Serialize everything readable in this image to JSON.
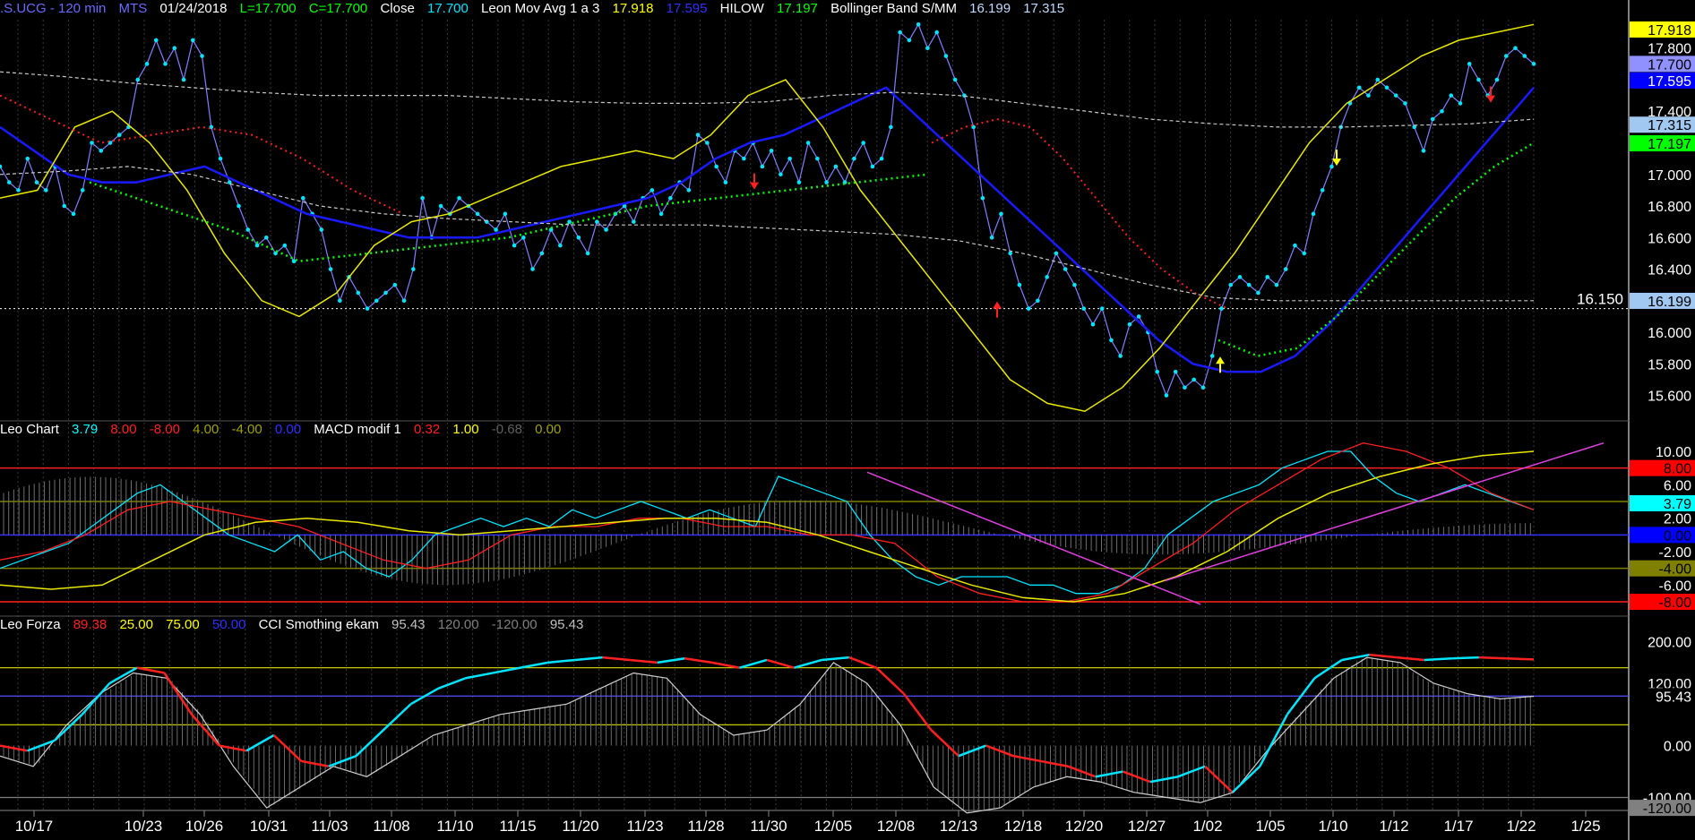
{
  "header": {
    "symbol": ".S.UCG - 120 min",
    "source": "MTS",
    "date": "01/24/2018",
    "low": "L=17.700",
    "close": "C=17.700",
    "close_label": "Close",
    "close_val": "17.700",
    "ma_label": "Leon Mov Avg 1 a 3",
    "ma_val1": "17.918",
    "ma_val2": "17.595",
    "hilow_label": "HILOW",
    "hilow_val": "17.197",
    "boll_label": "Bollinger Band S/MM",
    "boll_val1": "16.199",
    "boll_val2": "17.315"
  },
  "macd_header": {
    "label": "Leo Chart",
    "v1": "3.79",
    "v2": "8.00",
    "v3": "-8.00",
    "v4": "4.00",
    "v5": "-4.00",
    "v6": "0.00",
    "macd_label": "MACD modif 1",
    "m1": "0.32",
    "m2": "1.00",
    "m3": "-0.68",
    "m4": "0.00"
  },
  "forza_header": {
    "label": "Leo Forza",
    "v1": "89.38",
    "v2": "25.00",
    "v3": "75.00",
    "v4": "50.00",
    "cci_label": "CCI Smothing ekam",
    "c1": "95.43",
    "c2": "120.00",
    "c3": "-120.00",
    "c4": "95.43"
  },
  "colors": {
    "price": "#00e5ff",
    "blue": "#1a1aff",
    "yellow": "#e8e800",
    "red": "#ff2020",
    "green": "#00ff00",
    "white": "#c8c8c8",
    "magenta": "#e040e0"
  },
  "chart_data": [
    {
      "type": "line",
      "panel": "price",
      "ylim": [
        15.45,
        17.98
      ],
      "y_ticks": [
        "17.800",
        "17.400",
        "17.000",
        "16.800",
        "16.600",
        "16.400",
        "16.000",
        "15.800",
        "15.600"
      ],
      "y_tick_values": [
        17.8,
        17.4,
        17.0,
        16.8,
        16.6,
        16.4,
        16.0,
        15.8,
        15.6
      ],
      "hline_label": "16.150",
      "hline_value": 16.15,
      "tags": [
        {
          "text": "17.918",
          "value": 17.918,
          "bg": "#ffff00",
          "fg": "#000"
        },
        {
          "text": "17.700",
          "value": 17.7,
          "bg": "#9090ff",
          "fg": "#000"
        },
        {
          "text": "17.595",
          "value": 17.595,
          "bg": "#0000ff",
          "fg": "#fff"
        },
        {
          "text": "17.315",
          "value": 17.315,
          "bg": "#a0c8f0",
          "fg": "#000"
        },
        {
          "text": "17.197",
          "value": 17.197,
          "bg": "#00ff00",
          "fg": "#000"
        },
        {
          "text": "16.199",
          "value": 16.199,
          "bg": "#a0c8f0",
          "fg": "#000"
        }
      ],
      "x_ticks": [
        "10/17",
        "10/23",
        "10/26",
        "10/31",
        "11/03",
        "11/08",
        "11/10",
        "11/15",
        "11/20",
        "11/23",
        "11/28",
        "11/30",
        "12/05",
        "12/08",
        "12/13",
        "12/18",
        "12/20",
        "12/27",
        "1/02",
        "1/05",
        "1/10",
        "1/12",
        "1/17",
        "1/22",
        "1/25"
      ],
      "series": [
        {
          "role": "close",
          "values": [
            17.05,
            16.95,
            16.9,
            17.1,
            16.95,
            16.9,
            17.05,
            16.8,
            16.75,
            16.9,
            17.2,
            17.15,
            17.2,
            17.25,
            17.3,
            17.6,
            17.7,
            17.85,
            17.7,
            17.8,
            17.6,
            17.85,
            17.75,
            17.3,
            17.1,
            16.95,
            16.8,
            16.65,
            16.55,
            16.6,
            16.5,
            16.55,
            16.45,
            16.85,
            16.75,
            16.65,
            16.4,
            16.2,
            16.35,
            16.25,
            16.15,
            16.2,
            16.25,
            16.3,
            16.2,
            16.4,
            16.85,
            16.6,
            16.8,
            16.75,
            16.85,
            16.8,
            16.75,
            16.7,
            16.65,
            16.75,
            16.55,
            16.6,
            16.4,
            16.5,
            16.65,
            16.55,
            16.7,
            16.6,
            16.5,
            16.7,
            16.65,
            16.75,
            16.8,
            16.7,
            16.85,
            16.9,
            16.75,
            16.85,
            16.95,
            16.9,
            17.25,
            17.2,
            17.05,
            16.95,
            17.15,
            17.1,
            17.2,
            17.05,
            17.15,
            17.0,
            17.1,
            16.95,
            17.2,
            17.1,
            16.95,
            17.05,
            16.95,
            17.1,
            17.2,
            17.05,
            17.1,
            17.3,
            17.9,
            17.85,
            17.95,
            17.8,
            17.9,
            17.75,
            17.6,
            17.5,
            17.3,
            16.85,
            16.6,
            16.75,
            16.5,
            16.3,
            16.15,
            16.2,
            16.35,
            16.5,
            16.4,
            16.3,
            16.15,
            16.05,
            16.15,
            15.95,
            15.85,
            16.05,
            16.1,
            16.0,
            15.75,
            15.6,
            15.75,
            15.65,
            15.7,
            15.65,
            15.85,
            16.15,
            16.3,
            16.35,
            16.3,
            16.25,
            16.35,
            16.3,
            16.4,
            16.55,
            16.5,
            16.75,
            16.9,
            17.05,
            17.3,
            17.45,
            17.55,
            17.5,
            17.6,
            17.55,
            17.5,
            17.45,
            17.3,
            17.15,
            17.35,
            17.4,
            17.5,
            17.45,
            17.7,
            17.6,
            17.5,
            17.6,
            17.75,
            17.8,
            17.75,
            17.7
          ]
        },
        {
          "role": "leon_avg_blue",
          "values": [
            17.3,
            17.15,
            17.0,
            16.95,
            16.95,
            17.0,
            17.05,
            16.95,
            16.85,
            16.75,
            16.7,
            16.65,
            16.6,
            16.6,
            16.6,
            16.65,
            16.7,
            16.75,
            16.8,
            16.85,
            16.95,
            17.1,
            17.2,
            17.25,
            17.35,
            17.45,
            17.55,
            17.35,
            17.15,
            16.95,
            16.75,
            16.55,
            16.35,
            16.15,
            15.95,
            15.8,
            15.75,
            15.75,
            15.85,
            16.05,
            16.3,
            16.55,
            16.8,
            17.05,
            17.3,
            17.55
          ]
        },
        {
          "role": "leon_avg_yellow",
          "values": [
            16.85,
            16.9,
            17.3,
            17.4,
            17.2,
            16.9,
            16.5,
            16.2,
            16.1,
            16.25,
            16.55,
            16.7,
            16.75,
            16.85,
            16.95,
            17.05,
            17.1,
            17.15,
            17.1,
            17.25,
            17.5,
            17.6,
            17.3,
            16.9,
            16.6,
            16.3,
            16.0,
            15.7,
            15.55,
            15.5,
            15.65,
            15.9,
            16.2,
            16.5,
            16.85,
            17.2,
            17.45,
            17.6,
            17.75,
            17.85,
            17.9,
            17.95
          ]
        },
        {
          "role": "hilow_green",
          "values": [
            16.95,
            16.8,
            16.65,
            16.45,
            16.5,
            16.55,
            16.6,
            16.7,
            16.8,
            16.85,
            16.9,
            16.95,
            17.0
          ]
        },
        {
          "role": "hilow_green_2",
          "values": [
            15.95,
            15.85,
            15.9,
            16.1,
            16.35,
            16.6,
            16.85,
            17.05,
            17.2
          ]
        },
        {
          "role": "red_dotted",
          "values": [
            17.5,
            17.35,
            17.2,
            17.25,
            17.3,
            17.25,
            17.1,
            16.9,
            16.75
          ]
        },
        {
          "role": "red_dotted_2",
          "values": [
            17.2,
            17.3,
            17.35,
            17.3,
            17.1,
            16.85,
            16.6,
            16.4,
            16.25,
            16.15
          ]
        },
        {
          "role": "boll_upper",
          "values": [
            17.65,
            17.62,
            17.58,
            17.55,
            17.52,
            17.5,
            17.5,
            17.5,
            17.48,
            17.46,
            17.45,
            17.45,
            17.46,
            17.5,
            17.52,
            17.5,
            17.45,
            17.4,
            17.35,
            17.32,
            17.3,
            17.3,
            17.31,
            17.32,
            17.35
          ]
        },
        {
          "role": "boll_lower",
          "values": [
            17.0,
            17.02,
            17.05,
            17.0,
            16.9,
            16.8,
            16.75,
            16.72,
            16.7,
            16.68,
            16.68,
            16.68,
            16.66,
            16.64,
            16.62,
            16.58,
            16.5,
            16.4,
            16.3,
            16.22,
            16.2,
            16.2,
            16.2,
            16.2,
            16.2
          ]
        }
      ]
    },
    {
      "type": "line",
      "panel": "macd",
      "ylim": [
        -9.5,
        11.5
      ],
      "y_ticks": [
        "10.00",
        "6.00",
        "2.00",
        "-2.00",
        "-6.00"
      ],
      "y_tick_values": [
        10,
        6,
        2,
        -2,
        -6
      ],
      "tags": [
        {
          "text": "8.00",
          "value": 8,
          "bg": "#ff0000",
          "fg": "#000"
        },
        {
          "text": "3.79",
          "value": 3.79,
          "bg": "#00ffff",
          "fg": "#000"
        },
        {
          "text": "0.00",
          "value": 0,
          "bg": "#0000ff",
          "fg": "#000"
        },
        {
          "text": "-4.00",
          "value": -4,
          "bg": "#808000",
          "fg": "#000"
        },
        {
          "text": "-8.00",
          "value": -8,
          "bg": "#ff0000",
          "fg": "#000"
        }
      ],
      "series": [
        {
          "role": "cyan",
          "values": [
            -4,
            -3,
            -2,
            -1,
            1,
            3,
            5,
            6,
            4,
            2,
            0,
            -1,
            -2,
            0,
            -3,
            -2,
            -4,
            -5,
            -3,
            0,
            1,
            2,
            1,
            2,
            1,
            3,
            2,
            3,
            4,
            3,
            2,
            3,
            2,
            1,
            7,
            6,
            5,
            4,
            0,
            -3,
            -5,
            -6,
            -5,
            -5,
            -5,
            -6,
            -6,
            -7,
            -7,
            -6,
            -4,
            0,
            2,
            4,
            5,
            6,
            8,
            9,
            10,
            10,
            7,
            5,
            4,
            5,
            6,
            5,
            4,
            3
          ]
        },
        {
          "role": "red",
          "values": [
            -3,
            -2,
            0,
            3,
            4,
            3,
            2,
            1,
            -1,
            -3,
            -4,
            -3,
            0,
            1,
            1,
            2,
            2,
            1,
            1,
            0,
            0,
            -1,
            -5,
            -7,
            -8,
            -8,
            -7,
            -4,
            -1,
            3,
            6,
            9,
            11,
            10,
            8,
            5,
            3
          ]
        },
        {
          "role": "yellow",
          "values": [
            -6,
            -6.5,
            -6,
            -3,
            0,
            1.5,
            2,
            1.5,
            0.5,
            0,
            0.5,
            1,
            1.5,
            2,
            2,
            1.5,
            0,
            -2,
            -4,
            -6,
            -7.5,
            -8,
            -7,
            -5,
            -2,
            2,
            5,
            7,
            8.5,
            9.5,
            10
          ]
        },
        {
          "role": "magenta_1",
          "values": [
            7.5,
            -8.3
          ]
        },
        {
          "role": "magenta_2",
          "values": [
            -5.5,
            11
          ]
        }
      ]
    },
    {
      "type": "line",
      "panel": "forza",
      "ylim": [
        -125,
        215
      ],
      "y_ticks": [
        "200.00",
        "120.00",
        "0.00",
        "-100.00"
      ],
      "y_tick_values": [
        200,
        120,
        0,
        -100
      ],
      "tags": [
        {
          "text": "95.43",
          "value": 95.43,
          "bg": "#000",
          "fg": "#fff"
        },
        {
          "text": "-120.00",
          "value": -120,
          "bg": "#808080",
          "fg": "#000"
        }
      ],
      "series": [
        {
          "role": "forza_line",
          "values": [
            0,
            -10,
            10,
            60,
            120,
            150,
            140,
            60,
            0,
            -10,
            20,
            -30,
            -40,
            -20,
            30,
            80,
            110,
            130,
            140,
            150,
            160,
            165,
            170,
            165,
            160,
            168,
            160,
            150,
            165,
            150,
            165,
            170,
            150,
            100,
            30,
            -20,
            0,
            -20,
            -30,
            -40,
            -60,
            -50,
            -70,
            -60,
            -40,
            -90,
            -40,
            60,
            130,
            165,
            175,
            170,
            165,
            168,
            170,
            168,
            166
          ]
        },
        {
          "role": "cci",
          "values": [
            -20,
            -40,
            40,
            100,
            140,
            130,
            60,
            -40,
            -120,
            -80,
            -40,
            -60,
            -20,
            20,
            40,
            60,
            70,
            80,
            110,
            140,
            130,
            60,
            20,
            30,
            80,
            160,
            120,
            40,
            -80,
            -130,
            -120,
            -80,
            -60,
            -70,
            -90,
            -100,
            -110,
            -90,
            -10,
            60,
            130,
            170,
            160,
            120,
            100,
            90,
            95
          ]
        }
      ]
    }
  ]
}
